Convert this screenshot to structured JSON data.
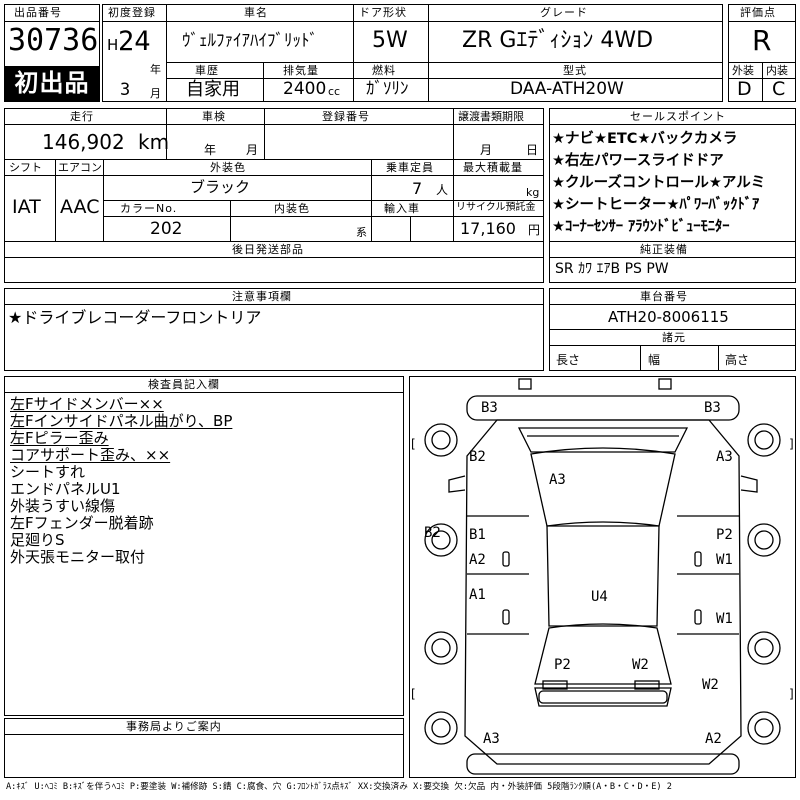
{
  "header": {
    "lot_label": "出品番号",
    "lot_no": "30736",
    "first_badge": "初出品",
    "reg_label": "初度登録",
    "era": "H",
    "year": "24",
    "year_unit": "年",
    "month": "3",
    "month_unit": "月",
    "name_label": "車名",
    "name": "ｳﾞｪﾙﾌｧｲｱﾊｲﾌﾞﾘｯﾄﾞ",
    "door_label": "ドア形状",
    "door": "5W",
    "grade_label": "グレード",
    "grade": "ZR Gｴﾃﾞｨｼｮﾝ 4WD",
    "score_label": "評価点",
    "score": "R",
    "history_label": "車歴",
    "history": "自家用",
    "disp_label": "排気量",
    "disp": "2400",
    "disp_unit": "cc",
    "fuel_label": "燃料",
    "fuel": "ｶﾞｿﾘﾝ",
    "model_label": "型式",
    "model": "DAA-ATH20W",
    "ext_label": "外装",
    "ext": "D",
    "int_label": "内装",
    "int": "C"
  },
  "row2": {
    "mileage_label": "走行",
    "mileage": "146,902",
    "mileage_unit": "km",
    "inspection_label": "車検",
    "insp_year": "年",
    "insp_month": "月",
    "plate_label": "登録番号",
    "deadline_label": "譲渡書類期限",
    "dl_month": "月",
    "dl_day": "日",
    "shift_label": "シフト",
    "shift": "IAT",
    "ac_label": "エアコン",
    "ac": "AAC",
    "color_label": "外装色",
    "color": "ブラック",
    "seats_label": "乗車定員",
    "seats": "7",
    "seats_unit": "人",
    "load_label": "最大積載量",
    "load_unit": "kg",
    "colorno_label": "カラーNo.",
    "colorno": "202",
    "intcolor_label": "内装色",
    "intcolor_unit": "系",
    "import_label": "輸入車",
    "recycle_label": "リサイクル預託金",
    "recycle": "17,160",
    "recycle_unit": "円",
    "later_label": "後日発送部品"
  },
  "sales_points": {
    "label": "セールスポイント",
    "items": [
      "★ナビ★ETC★バックカメラ",
      "★右左パワースライドドア",
      "★クルーズコントロール★アルミ",
      "★シートヒーター★ﾊﾟﾜｰﾊﾞｯｸﾄﾞｱ",
      "★ｺｰﾅｰｾﾝｻｰ ｱﾗｳﾝﾄﾞﾋﾞｭｰﾓﾆﾀｰ"
    ]
  },
  "equipment": {
    "label": "純正装備",
    "value": "SR ｶﾜ ｴｱB PS PW"
  },
  "notes": {
    "label": "注意事項欄",
    "value": "★ドライブレコーダーフロントリア"
  },
  "chassis": {
    "label": "車台番号",
    "value": "ATH20-8006115",
    "dims_label": "諸元",
    "length": "長さ",
    "width": "幅",
    "height": "高さ"
  },
  "inspector": {
    "label": "検査員記入欄",
    "lines": [
      {
        "text": "左Fサイドメンバー××",
        "ul": true
      },
      {
        "text": "左Fインサイドパネル曲がり、BP",
        "ul": true
      },
      {
        "text": "左Fピラー歪み",
        "ul": true
      },
      {
        "text": "コアサポート歪み、××",
        "ul": true
      },
      {
        "text": "シートすれ",
        "ul": false
      },
      {
        "text": "エンドパネルU1",
        "ul": false
      },
      {
        "text": "外装うすい線傷",
        "ul": false
      },
      {
        "text": "左Fフェンダー脱着跡",
        "ul": false
      },
      {
        "text": "足廻りS",
        "ul": false
      },
      {
        "text": "外天張モニター取付",
        "ul": false
      }
    ]
  },
  "office": {
    "label": "事務局よりご案内"
  },
  "diagram_marks": [
    "B3",
    "B3",
    "B2",
    "A3",
    "A3",
    "B2",
    "B1",
    "P2",
    "A2",
    "W1",
    "A1",
    "U4",
    "W1",
    "P2",
    "W2",
    "W2",
    "A3",
    "A2"
  ],
  "legend": "A:ｷｽﾞ U:ﾍｺﾐ B:ｷｽﾞを伴うﾍｺﾐ P:要塗装 W:補修跡 S:錆 C:腐食、穴 G:ﾌﾛﾝﾄｶﾞﾗｽ点ｷｽﾞ XX:交換済み X:要交換 欠:欠品 内・外装評価 5段階ﾗﾝｸ順(A・B・C・D・E) 2"
}
